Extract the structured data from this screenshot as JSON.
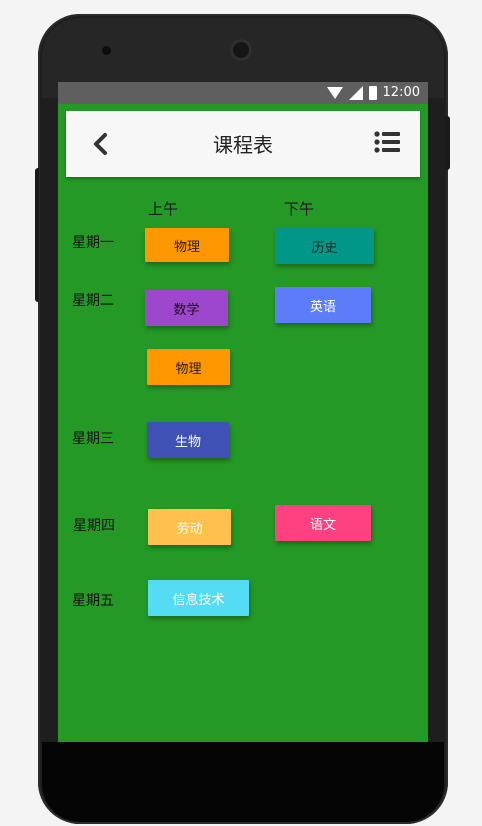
{
  "status": {
    "time": "12:00",
    "icons": [
      "wifi-icon",
      "signal-icon",
      "battery-icon"
    ]
  },
  "appbar": {
    "title": "课程表",
    "back_icon": "chevron-left-icon",
    "menu_icon": "list-icon"
  },
  "columns": {
    "morning": "上午",
    "afternoon": "下午"
  },
  "days": {
    "mon": "星期一",
    "tue": "星期二",
    "wed": "星期三",
    "thu": "星期四",
    "fri": "星期五"
  },
  "courses": {
    "mon_am": {
      "name": "物理",
      "color": "#ff9800",
      "text_color": "#2a1a00"
    },
    "mon_pm": {
      "name": "历史",
      "color": "#009688",
      "text_color": "#0d2b28"
    },
    "tue_am1": {
      "name": "数学",
      "color": "#9c47cc",
      "text_color": "#1c0b26"
    },
    "tue_pm": {
      "name": "英语",
      "color": "#5c7cfa",
      "text_color": "#ffffff"
    },
    "tue_am2": {
      "name": "物理",
      "color": "#ff9800",
      "text_color": "#2a1a00"
    },
    "wed_am": {
      "name": "生物",
      "color": "#3f51b5",
      "text_color": "#ffffff"
    },
    "thu_am": {
      "name": "劳动",
      "color": "#ffc04d",
      "text_color": "#ffffff"
    },
    "thu_pm": {
      "name": "语文",
      "color": "#ff4081",
      "text_color": "#ffffff"
    },
    "fri_am": {
      "name": "信息技术",
      "color": "#55dcf5",
      "text_color": "#ffffff"
    }
  },
  "colors": {
    "background": "#259926",
    "statusbar": "#5f5f5f",
    "appbar": "#f7f7f7"
  }
}
